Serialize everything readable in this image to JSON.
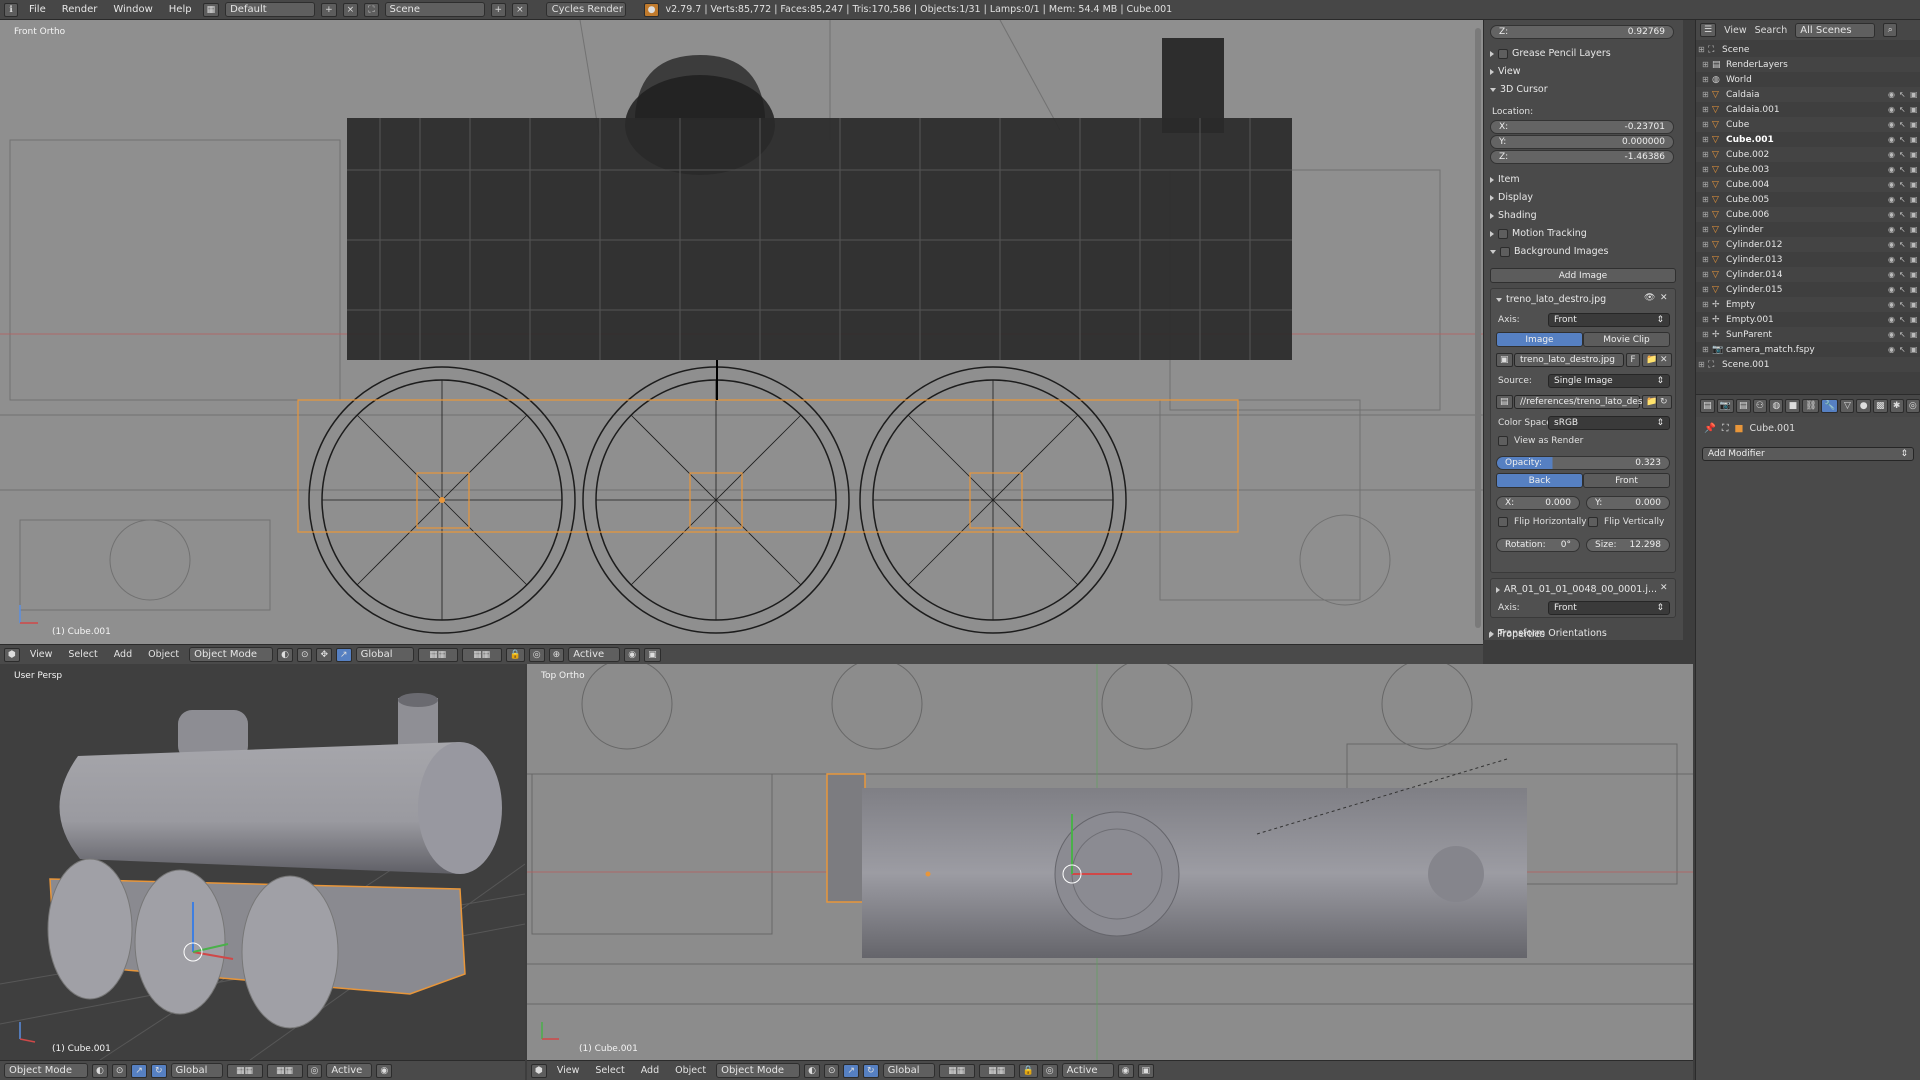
{
  "infobar": {
    "menus": [
      "File",
      "Render",
      "Window",
      "Help"
    ],
    "layout": "Default",
    "scene": "Scene",
    "engine": "Cycles Render",
    "stats": "v2.79.7 | Verts:85,772 | Faces:85,247 | Tris:170,586 | Objects:1/31 | Lamps:0/1 | Mem: 54.4 MB | Cube.001"
  },
  "viewport_front": {
    "label": "Front Ortho",
    "object_info": "(1) Cube.001"
  },
  "viewport_persp": {
    "label": "User Persp",
    "object_info": "(1) Cube.001"
  },
  "viewport_top": {
    "label": "Top Ortho",
    "object_info": "(1) Cube.001"
  },
  "view_header": {
    "menus": [
      "View",
      "Select",
      "Add",
      "Object"
    ],
    "mode": "Object Mode",
    "orientation": "Global",
    "pivot": "Active"
  },
  "npanel": {
    "z_top": {
      "label": "Z:",
      "value": "0.92769"
    },
    "sections": {
      "grease_pencil": "Grease Pencil Layers",
      "view": "View",
      "cursor": "3D Cursor",
      "item": "Item",
      "display": "Display",
      "shading": "Shading",
      "motion_tracking": "Motion Tracking",
      "background_images": "Background Images",
      "transform_orientations": "Transform Orientations",
      "properties": "Properties"
    },
    "location_label": "Location:",
    "cursor": {
      "x": {
        "label": "X:",
        "value": "-0.23701"
      },
      "y": {
        "label": "Y:",
        "value": "0.000000"
      },
      "z": {
        "label": "Z:",
        "value": "-1.46386"
      }
    },
    "add_image": "Add Image",
    "bg1": {
      "name": "treno_lato_destro.jpg",
      "axis_label": "Axis:",
      "axis": "Front",
      "tab_image": "Image",
      "tab_movie": "Movie Clip",
      "image_name": "treno_lato_destro.jpg",
      "image_flag": "F",
      "source_label": "Source:",
      "source": "Single Image",
      "filepath": "//references/treno_lato_destro.jpg",
      "colorspace_label": "Color Space:",
      "colorspace": "sRGB",
      "view_as_render": "View as Render",
      "opacity_label": "Opacity:",
      "opacity": "0.323",
      "opacity_fraction": 0.323,
      "back": "Back",
      "front": "Front",
      "x": {
        "label": "X:",
        "value": "0.000"
      },
      "y": {
        "label": "Y:",
        "value": "0.000"
      },
      "flip_h": "Flip Horizontally",
      "flip_v": "Flip Vertically",
      "rotation": {
        "label": "Rotation:",
        "value": "0°"
      },
      "size": {
        "label": "Size:",
        "value": "12.298"
      }
    },
    "bg2": {
      "name": "AR_01_01_01_0048_00_0001.j...",
      "axis_label": "Axis:",
      "axis": "Front"
    }
  },
  "outliner": {
    "header": {
      "view": "View",
      "search": "Search",
      "filter": "All Scenes"
    },
    "items": [
      {
        "name": "Scene",
        "icon": "scene-icon"
      },
      {
        "name": "RenderLayers",
        "icon": "renderlayers-icon"
      },
      {
        "name": "World",
        "icon": "world-icon"
      },
      {
        "name": "Caldaia",
        "icon": "mesh-icon"
      },
      {
        "name": "Caldaia.001",
        "icon": "mesh-icon"
      },
      {
        "name": "Cube",
        "icon": "mesh-icon"
      },
      {
        "name": "Cube.001",
        "icon": "mesh-icon"
      },
      {
        "name": "Cube.002",
        "icon": "mesh-icon"
      },
      {
        "name": "Cube.003",
        "icon": "mesh-icon"
      },
      {
        "name": "Cube.004",
        "icon": "mesh-icon"
      },
      {
        "name": "Cube.005",
        "icon": "mesh-icon"
      },
      {
        "name": "Cube.006",
        "icon": "mesh-icon"
      },
      {
        "name": "Cylinder",
        "icon": "mesh-icon"
      },
      {
        "name": "Cylinder.012",
        "icon": "mesh-icon"
      },
      {
        "name": "Cylinder.013",
        "icon": "mesh-icon"
      },
      {
        "name": "Cylinder.014",
        "icon": "mesh-icon"
      },
      {
        "name": "Cylinder.015",
        "icon": "mesh-icon"
      },
      {
        "name": "Empty",
        "icon": "empty-icon"
      },
      {
        "name": "Empty.001",
        "icon": "empty-icon"
      },
      {
        "name": "SunParent",
        "icon": "empty-icon"
      },
      {
        "name": "camera_match.fspy",
        "icon": "camera-icon"
      },
      {
        "name": "Scene.001",
        "icon": "scene-icon"
      }
    ]
  },
  "props": {
    "object": "Cube.001",
    "add_modifier": "Add Modifier"
  },
  "colors": {
    "selection": "#e8963a",
    "active_button": "#5680c2",
    "viewport": "#8f8f8f",
    "panel": "#4a4a4a"
  }
}
